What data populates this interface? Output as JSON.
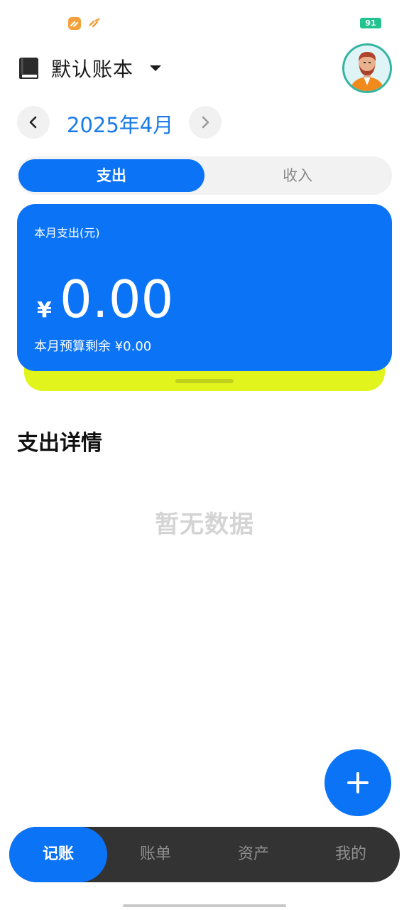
{
  "status_bar": {
    "battery": "91"
  },
  "header": {
    "book_name": "默认账本"
  },
  "month_nav": {
    "current": "2025年4月"
  },
  "segment": {
    "expense_label": "支出",
    "income_label": "收入"
  },
  "summary_card": {
    "label": "本月支出(元)",
    "currency_symbol": "¥",
    "amount": "0.00",
    "budget_text": "本月预算剩余 ¥0.00"
  },
  "details": {
    "title": "支出详情",
    "empty_text": "暂无数据"
  },
  "tabbar": {
    "items": [
      {
        "label": "记账"
      },
      {
        "label": "账单"
      },
      {
        "label": "资产"
      },
      {
        "label": "我的"
      }
    ]
  },
  "colors": {
    "accent": "#0b73f6",
    "card_under": "#e1f51d",
    "tabbar": "#333333"
  },
  "icons": [
    "book-icon",
    "caret-down-icon",
    "chevron-left-icon",
    "chevron-right-icon",
    "plus-icon",
    "avatar"
  ]
}
